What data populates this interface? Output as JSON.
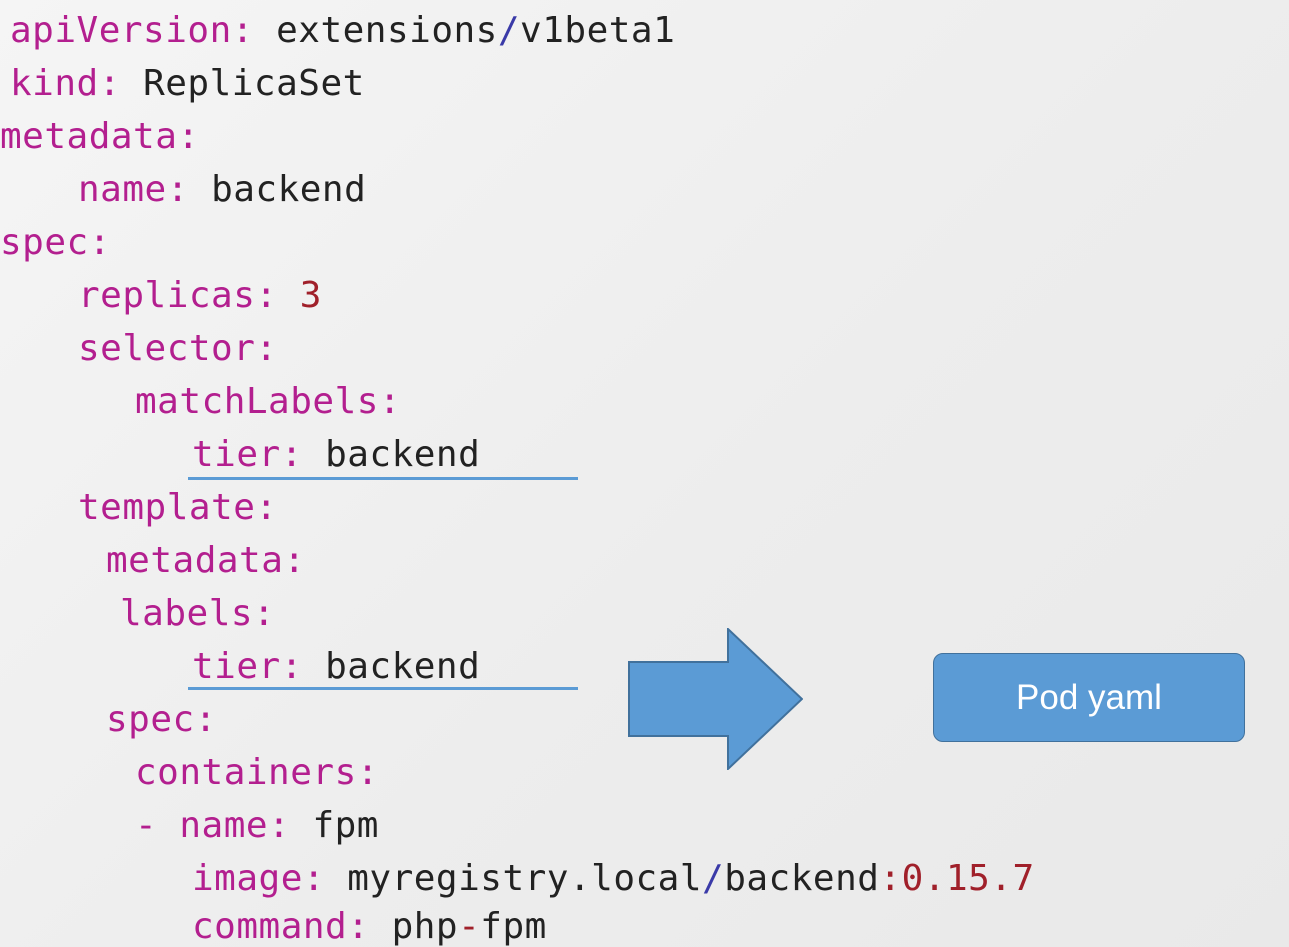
{
  "code": {
    "api_key": "apiVersion:",
    "api_val_a": "extensions",
    "api_slash": "/",
    "api_val_b": "v1beta1",
    "kind_key": "kind:",
    "kind_val": "ReplicaSet",
    "metadata_key": "metadata:",
    "name_key": "name:",
    "name_val": "backend",
    "spec_key": "spec:",
    "replicas_key": "replicas:",
    "replicas_val": "3",
    "selector_key": "selector:",
    "matchlabels_key": "matchLabels:",
    "tier_key_1": "tier:",
    "tier_val_1": "backend",
    "template_key": "template:",
    "tmpl_metadata_key": "metadata:",
    "labels_key": "labels:",
    "tier_key_2": "tier:",
    "tier_val_2": "backend",
    "tmpl_spec_key": "spec:",
    "containers_key": "containers:",
    "dash": "-",
    "cname_key": "name:",
    "cname_val": "fpm",
    "image_key": "image:",
    "image_val_a": "myregistry.local",
    "image_slash": "/",
    "image_val_b": "backend",
    "image_colon": ":",
    "image_tag": "0.15.7",
    "command_key": "command:",
    "command_val_a": "php",
    "command_dash": "-",
    "command_val_b": "fpm"
  },
  "callout": {
    "label": "Pod yaml"
  },
  "colors": {
    "key": "#b31f8f",
    "value": "#222222",
    "number": "#a0202a",
    "separator": "#3a3aa8",
    "accent": "#5b9bd5"
  },
  "icons": {
    "arrow": "right-arrow-icon"
  }
}
